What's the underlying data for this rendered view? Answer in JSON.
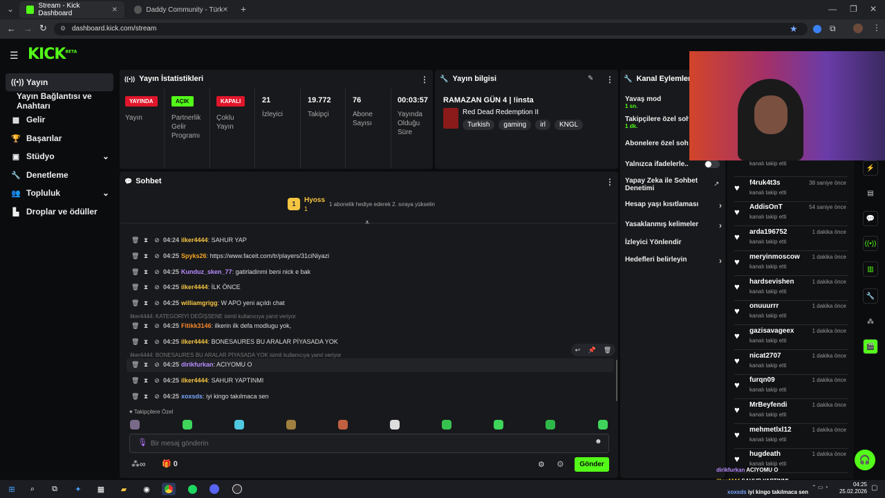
{
  "browser": {
    "tabs": [
      {
        "label": "Stream - Kick Dashboard",
        "active": true
      },
      {
        "label": "Daddy Community - Türkiye'nin",
        "active": false
      }
    ],
    "url": "dashboard.kick.com/stream"
  },
  "app": {
    "logo": "KICK",
    "logo_badge": "BETA"
  },
  "sidebar": {
    "items": [
      {
        "label": "Yayın",
        "icon": "broadcast-icon"
      },
      {
        "label": "Yayın Bağlantısı ve Anahtarı",
        "icon": ""
      },
      {
        "label": "Gelir",
        "icon": "revenue-icon"
      },
      {
        "label": "Başarılar",
        "icon": "trophy-icon"
      },
      {
        "label": "Stüdyo",
        "icon": "studio-icon"
      },
      {
        "label": "Denetleme",
        "icon": "wrench-icon"
      },
      {
        "label": "Topluluk",
        "icon": "community-icon"
      },
      {
        "label": "Droplar ve ödüller",
        "icon": "drops-icon"
      }
    ]
  },
  "stats": {
    "title": "Yayın İstatistikleri",
    "badges": [
      {
        "badge": "YAYINDA",
        "label": "Yayın",
        "color": "#e0162b"
      },
      {
        "badge": "AÇIK",
        "label": "Partnerlik Gelir Programı",
        "color": "#53fc18"
      },
      {
        "badge": "KAPALI",
        "label": "Çoklu Yayın",
        "color": "#e0162b"
      }
    ],
    "values": [
      {
        "value": "21",
        "label": "İzleyici"
      },
      {
        "value": "19.772",
        "label": "Takipçi"
      },
      {
        "value": "76",
        "label": "Abone Sayısı"
      },
      {
        "value": "00:03:57",
        "label": "Yayında Olduğu Süre"
      }
    ]
  },
  "info": {
    "title": "Yayın bilgisi",
    "stream_title": "RAMAZAN GÜN 4 | !insta",
    "game": "Red Dead Redemption II",
    "tags": [
      "Turkish",
      "gaming",
      "irl",
      "KNGL"
    ]
  },
  "actions": {
    "title": "Kanal Eylemleri",
    "items": [
      {
        "label": "Yavaş mod",
        "sub": "1 sn."
      },
      {
        "label": "Takipçilere özel sohbet",
        "sub": "1 dk."
      },
      {
        "label": "Abonelere özel sohbet",
        "sub": ""
      },
      {
        "label": "Yalnızca ifadelerle...",
        "sub": ""
      },
      {
        "label": "Yapay Zeka ile Sohbet Denetimi",
        "sub": ""
      },
      {
        "label": "Hesap yaşı kısıtlaması",
        "sub": ""
      },
      {
        "label": "Yasaklanmış kelimeler",
        "sub": ""
      },
      {
        "label": "İzleyici Yönlendir",
        "sub": ""
      },
      {
        "label": "Hedefleri belirleyin",
        "sub": ""
      }
    ]
  },
  "chat": {
    "title": "Sohbet",
    "pinned_user": "Hyoss",
    "pinned_count": "1",
    "pinned_text": "1 abonelik hediye ederek 2. sıraya yükselin",
    "messages": [
      {
        "time": "04:24",
        "user": "ilker4444",
        "color": "#f5c542",
        "text": ": SAHUR YAP"
      },
      {
        "time": "04:25",
        "user": "Spyks26",
        "color": "#f5a623",
        "text": ": https://www.faceit.com/tr/players/31ciNiyazi"
      },
      {
        "time": "04:25",
        "user": "Kunduz_sken_77",
        "color": "#b78cff",
        "text": ": gatirladinmi beni nick e bak"
      },
      {
        "time": "04:25",
        "user": "ilker4444",
        "color": "#f5c542",
        "text": ": İLK ÖNCE"
      },
      {
        "time": "04:25",
        "user": "williamgrigg",
        "color": "#f5c542",
        "text": ": W APO yeni açıldı chat"
      },
      {
        "time": "04:25",
        "user": "Fitikk3146",
        "color": "#f5872e",
        "text": ": ilkerin ilk defa modlugu yok,"
      },
      {
        "time": "04:25",
        "user": "ilker4444",
        "color": "#f5c542",
        "text": ": BONESAURES BU ARALAR PİYASADA YOK"
      },
      {
        "time": "04:25",
        "user": "dirikfurkan",
        "color": "#b78cff",
        "text": ": ACIYOMU O"
      },
      {
        "time": "04:25",
        "user": "ilker4444",
        "color": "#f5c542",
        "text": ": SAHUR YAPTINMI"
      },
      {
        "time": "04:25",
        "user": "xoxsds",
        "color": "#7aa7ff",
        "text": ": iyi kingo takılmaca sen"
      }
    ],
    "replies": [
      "ilker4444: KATEGORİYİ DEĞİŞSENE isimli kullanıcıya yanıt veriyor",
      "ilker4444: BONESAURES BU ARALAR PİYASADA YOK isimli kullanıcıya yanıt veriyor"
    ],
    "emote_label": "Takipçilere Özel",
    "input_placeholder": "Bir mesaj gönderin",
    "send_label": "Gönder",
    "infinity": "∞",
    "gift_count": "0"
  },
  "followers": [
    {
      "name": "",
      "time": ""
    },
    {
      "name": "f4ruk4t3s",
      "time": "38 saniye önce"
    },
    {
      "name": "AddisOnT",
      "time": "54 saniye önce"
    },
    {
      "name": "arda196752",
      "time": "1 dakika önce"
    },
    {
      "name": "meryinmoscow",
      "time": "1 dakika önce"
    },
    {
      "name": "hardsevishen",
      "time": "1 dakika önce"
    },
    {
      "name": "onuuurrr",
      "time": "1 dakika önce"
    },
    {
      "name": "gazisavageex",
      "time": "1 dakika önce"
    },
    {
      "name": "nicat2707",
      "time": "1 dakika önce"
    },
    {
      "name": "furqn09",
      "time": "1 dakika önce"
    },
    {
      "name": "MrBeyfendi",
      "time": "1 dakika önce"
    },
    {
      "name": "mehmetlxl12",
      "time": "1 dakika önce"
    },
    {
      "name": "hugdeath",
      "time": "1 dakika önce"
    }
  ],
  "followed_label": "kanalı takip etti",
  "overlay": [
    {
      "user": "dirikfurkan",
      "text": "ACIYOMU O"
    },
    {
      "user": "ilker4444",
      "text": "SAHUR YAPTINMI"
    },
    {
      "user": "xoxsds",
      "text": "iyi kingo takılmaca sen"
    }
  ],
  "taskbar": {
    "time": "04:25",
    "date": "25.02.2026"
  },
  "colors": {
    "accent": "#53fc18",
    "live": "#e0162b",
    "panel": "#18191c"
  }
}
